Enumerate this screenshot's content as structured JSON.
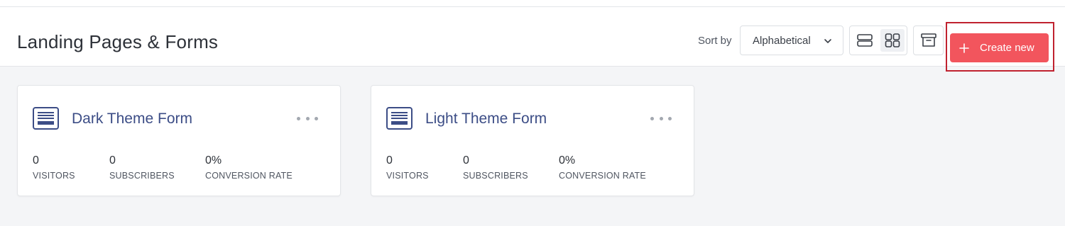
{
  "page": {
    "title": "Landing Pages & Forms"
  },
  "toolbar": {
    "sort_label": "Sort by",
    "sort_value": "Alphabetical",
    "create_label": "Create new",
    "accent_color": "#f2555d",
    "highlight_color": "#c0222f"
  },
  "icons": {
    "chevron": "chevron-down-icon",
    "list_view": "list-view-icon",
    "grid_view": "grid-view-icon",
    "archive": "archive-icon",
    "plus": "plus-icon",
    "form": "form-icon",
    "more": "more-options-icon"
  },
  "cards": [
    {
      "title": "Dark Theme Form",
      "stats": [
        {
          "value": "0",
          "label": "VISITORS"
        },
        {
          "value": "0",
          "label": "SUBSCRIBERS"
        },
        {
          "value": "0%",
          "label": "CONVERSION RATE"
        }
      ]
    },
    {
      "title": "Light Theme Form",
      "stats": [
        {
          "value": "0",
          "label": "VISITORS"
        },
        {
          "value": "0",
          "label": "SUBSCRIBERS"
        },
        {
          "value": "0%",
          "label": "CONVERSION RATE"
        }
      ]
    }
  ]
}
